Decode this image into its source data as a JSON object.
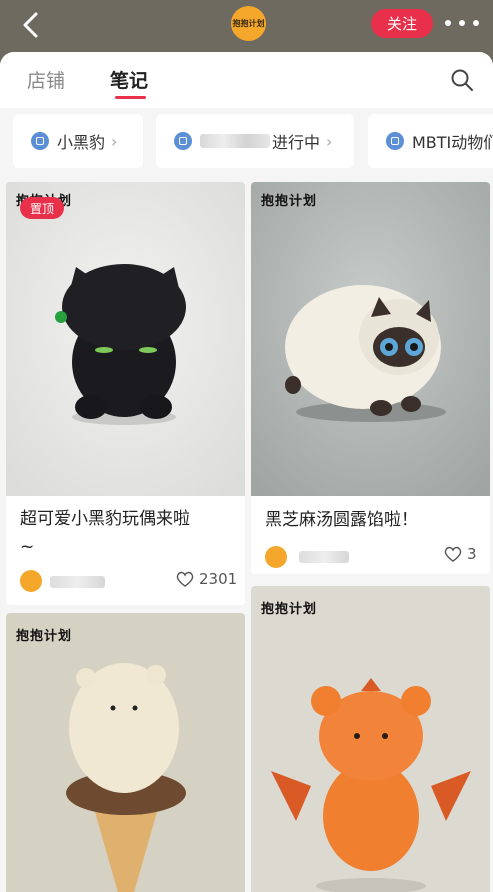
{
  "header": {
    "logo_text": "抱抱计划",
    "follow_label": "关注"
  },
  "tabs": {
    "store": "店铺",
    "notes": "笔记"
  },
  "chips": [
    {
      "label": "小黑豹"
    },
    {
      "label": "进行中"
    },
    {
      "label": "MBTI动物们"
    }
  ],
  "notes": [
    {
      "watermark": "抱抱计划",
      "pin_badge": "置顶",
      "title_line1": "超可爱小黑豹玩偶来啦",
      "title_line2": "~",
      "likes": "2301"
    },
    {
      "watermark": "抱抱计划",
      "title_line1": "黑芝麻汤圆露馅啦！",
      "likes": "3"
    },
    {
      "watermark": "抱抱计划"
    },
    {
      "watermark": "抱抱计划"
    }
  ],
  "colors": {
    "accent": "#e8304a",
    "brand": "#f4a72b"
  }
}
